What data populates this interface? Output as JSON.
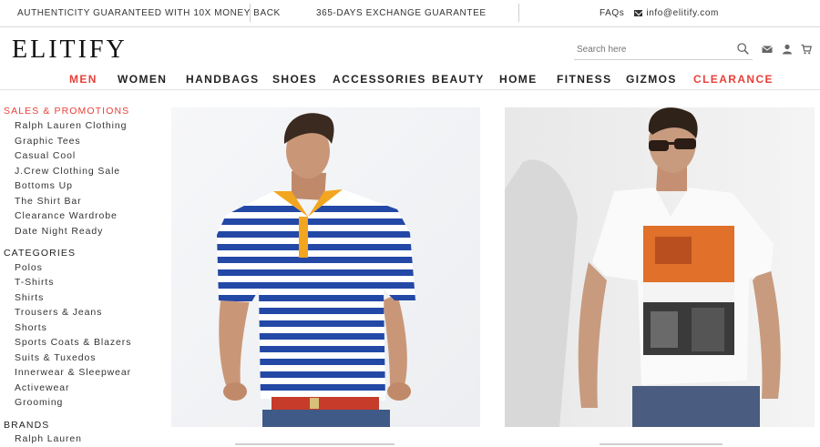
{
  "topbar": {
    "authenticity": "AUTHENTICITY GUARANTEED WITH 10X MONEY BACK",
    "exchange": "365-DAYS EXCHANGE GUARANTEE",
    "faqs": "FAQs",
    "email": "info@elitify.com",
    "email_icon": "envelope-icon"
  },
  "header": {
    "logo": "ELITIFY",
    "search_placeholder": "Search here",
    "icons": [
      "search-icon",
      "mail-icon",
      "user-icon",
      "cart-icon"
    ]
  },
  "nav": {
    "items": [
      {
        "label": "MEN",
        "active": true
      },
      {
        "label": "WOMEN"
      },
      {
        "label": "HANDBAGS"
      },
      {
        "label": "SHOES"
      },
      {
        "label": "ACCESSORIES"
      },
      {
        "label": "BEAUTY"
      },
      {
        "label": "HOME"
      },
      {
        "label": "FITNESS"
      },
      {
        "label": "GIZMOS"
      },
      {
        "label": "CLEARANCE",
        "highlight": true
      }
    ],
    "accent_color": "#e8413a"
  },
  "sidebar": {
    "sales_heading": "SALES & PROMOTIONS",
    "sales_items": [
      "Ralph Lauren Clothing",
      "Graphic Tees",
      "Casual Cool",
      "J.Crew Clothing Sale",
      "Bottoms Up",
      "The Shirt Bar",
      "Clearance Wardrobe",
      "Date Night Ready"
    ],
    "categories_heading": "CATEGORIES",
    "category_items": [
      "Polos",
      "T-Shirts",
      "Shirts",
      "Trousers & Jeans",
      "Shorts",
      "Sports Coats & Blazers",
      "Suits & Tuxedos",
      "Innerwear & Sleepwear",
      "Activewear",
      "Grooming"
    ],
    "brands_heading": "BRANDS",
    "brand_items": [
      "Ralph Lauren"
    ]
  },
  "products": [
    {
      "image": "man in blue and white striped polo shirt with yellow collar and red belt"
    },
    {
      "image": "man in sunglasses wearing white graphic t-shirt with orange print"
    }
  ]
}
